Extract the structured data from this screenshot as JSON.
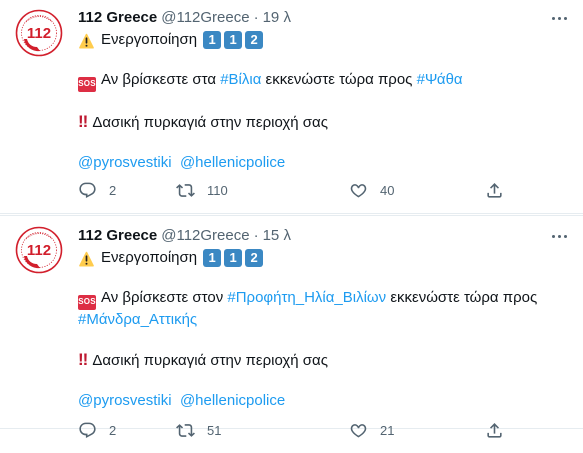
{
  "tweets": [
    {
      "name": "112 Greece",
      "handle": "@112Greece",
      "dot": "·",
      "time": "19 λ",
      "activation": "Ενεργοποίηση",
      "codes": [
        "1",
        "1",
        "2"
      ],
      "sos": "SOS",
      "text_a": "Αν βρίσκεστε στα ",
      "tag1": "#Βίλια",
      "text_b": " εκκενώστε τώρα προς ",
      "tag2": "#Ψάθα",
      "bang": "!!",
      "warning": "Δασική πυρκαγιά στην περιοχή σας",
      "mention1": "@pyrosvestiki",
      "mention2": "@hellenicpolice",
      "replies": "2",
      "retweets": "110",
      "likes": "40"
    },
    {
      "name": "112 Greece",
      "handle": "@112Greece",
      "dot": "·",
      "time": "15 λ",
      "activation": "Ενεργοποίηση",
      "codes": [
        "1",
        "1",
        "2"
      ],
      "sos": "SOS",
      "text_a": "Αν βρίσκεστε στον ",
      "tag1": "#Προφήτη_Ηλία_Βιλίων",
      "text_b": " εκκενώστε τώρα προς",
      "tag2": "#Μάνδρα_Αττικής",
      "bang": "!!",
      "warning": "Δασική πυρκαγιά στην περιοχή σας",
      "mention1": "@pyrosvestiki",
      "mention2": "@hellenicpolice",
      "replies": "2",
      "retweets": "51",
      "likes": "21"
    }
  ],
  "avatar": {
    "number": "112"
  },
  "colors": {
    "link": "#1d9bf0",
    "muted": "#536471",
    "avatar_red": "#d21f2c",
    "keycap": "#3b88c3",
    "sos": "#dd2e44"
  },
  "icons": {
    "reply": "reply-icon",
    "retweet": "retweet-icon",
    "like": "heart-icon",
    "share": "share-icon",
    "more": "more-icon"
  }
}
